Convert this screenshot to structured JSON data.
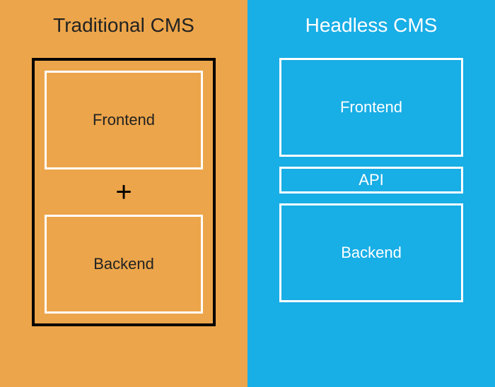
{
  "left": {
    "title": "Traditional CMS",
    "frontend": "Frontend",
    "plus": "+",
    "backend": "Backend",
    "bg": "#eca54a"
  },
  "right": {
    "title": "Headless CMS",
    "frontend": "Frontend",
    "api": "API",
    "backend": "Backend",
    "bg": "#18aee6"
  }
}
